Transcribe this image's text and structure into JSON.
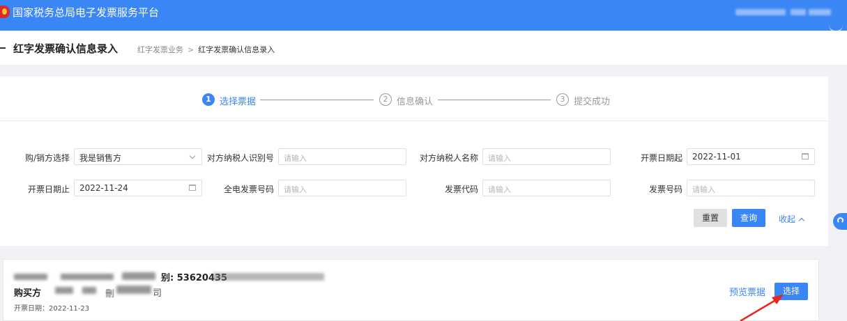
{
  "app": {
    "title": "国家税务总局电子发票服务平台"
  },
  "page": {
    "title": "红字发票确认信息录入",
    "breadcrumb": [
      "红字发票业务",
      "红字发票确认信息录入"
    ],
    "breadcrumb_sep": ">"
  },
  "steps": [
    {
      "number": "1",
      "label": "选择票据",
      "active": true
    },
    {
      "number": "2",
      "label": "信息确认",
      "active": false
    },
    {
      "number": "3",
      "label": "提交成功",
      "active": false
    }
  ],
  "form": {
    "buyer_seller_label": "购/销方选择",
    "buyer_seller_value": "我是销售方",
    "counterparty_tax_id_label": "对方纳税人识别号",
    "counterparty_tax_id_placeholder": "请输入",
    "counterparty_name_label": "对方纳税人名称",
    "counterparty_name_placeholder": "请输入",
    "date_from_label": "开票日期起",
    "date_from_value": "2022-11-01",
    "date_to_label": "开票日期止",
    "date_to_value": "2022-11-24",
    "full_invoice_no_label": "全电发票号码",
    "full_invoice_no_placeholder": "请输入",
    "invoice_code_label": "发票代码",
    "invoice_code_placeholder": "请输入",
    "invoice_no_label": "发票号码",
    "invoice_no_placeholder": "请输入"
  },
  "actions": {
    "reset": "重置",
    "query": "查询",
    "collapse": "收起"
  },
  "result": {
    "seller_id_fragment": "别: 53620435",
    "buyer_label": "购买方",
    "buyer_fragment_a": "刪",
    "buyer_fragment_b": "司",
    "date_line": "开票日期：2022-11-23",
    "preview": "预览票据",
    "select": "选择"
  },
  "colors": {
    "primary": "#3b86f5",
    "annotation_arrow": "#e8261d"
  }
}
